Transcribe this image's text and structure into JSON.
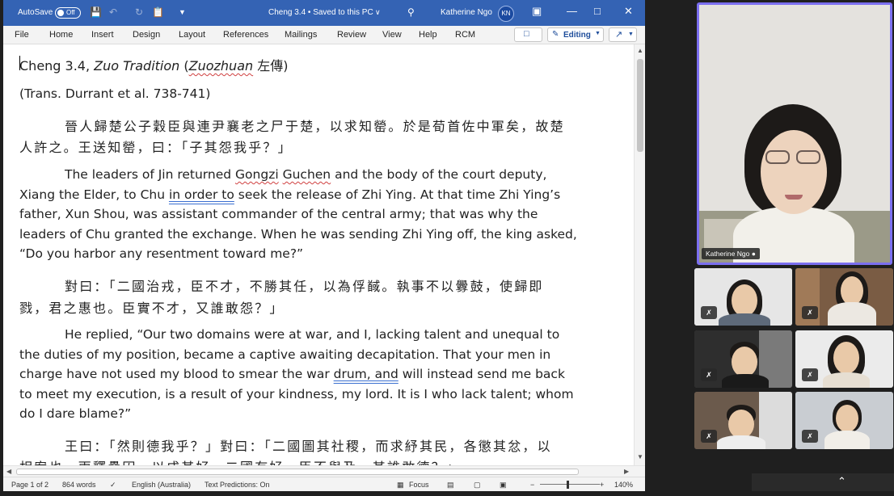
{
  "titlebar": {
    "autosave_label": "AutoSave",
    "autosave_state": "Off",
    "doc_title": "Cheng 3.4 • Saved to this PC",
    "user_name": "Katherine Ngo",
    "user_initials": "KN"
  },
  "menu": {
    "items": [
      "File",
      "Home",
      "Insert",
      "Design",
      "Layout",
      "References",
      "Mailings",
      "Review",
      "View",
      "Help",
      "RCM"
    ],
    "editing_label": "Editing"
  },
  "document": {
    "title_prefix": "Cheng 3.4, ",
    "title_italic": "Zuo Tradition",
    "title_paren_open": " (",
    "title_romanized": "Zuozhuan",
    "title_chinese": " 左傳)",
    "trans_line": "(Trans. Durrant et al. 738-741)",
    "zh1_line1": "晉人歸楚公子穀臣與連尹襄老之尸于楚，以求知罃。於是荀首佐中軍矣，故楚",
    "zh1_line2": "人許之。王送知罃，曰：「子其怨我乎？」",
    "en1_line1_a": "The leaders of Jin returned ",
    "en1_line1_b": "Gongzi",
    "en1_line1_c": " ",
    "en1_line1_d": "Guchen",
    "en1_line1_e": " and the body of the court deputy,",
    "en1_line2_a": "Xiang the Elder, to Chu ",
    "en1_line2_b": "in order to",
    "en1_line2_c": " seek the release of Zhi Ying. At that time Zhi Ying’s",
    "en1_line3": "father, Xun Shou, was assistant commander of the central army; that was why the",
    "en1_line4": "leaders of Chu granted the exchange. When he was sending Zhi Ying off, the king asked,",
    "en1_line5": "“Do you harbor any resentment toward me?”",
    "zh2_line1": "對曰：「二國治戎，臣不才，不勝其任，以為俘馘。執事不以釁鼓，使歸即",
    "zh2_line2": "戮，君之惠也。臣實不才，又誰敢怨？」",
    "en2_line1": "He replied, “Our two domains were at war, and I, lacking talent and unequal to",
    "en2_line2": "the duties of my position, became a captive awaiting decapitation. That your men in",
    "en2_line3_a": "charge have not used my blood to smear the war ",
    "en2_line3_b": "drum, and",
    "en2_line3_c": " will instead send me back",
    "en2_line4": "to meet my execution, is a result of your kindness, my lord. It is I who lack talent; whom",
    "en2_line5": "do I dare blame?”",
    "zh3_line1": "王曰：「然則德我乎？」對曰：「二國圖其社稷，而求紓其民，各懲其忿，以",
    "zh3_line2": "相宥也，兩釋纍囚，以成其好。二國有好，臣不與及，其誰敢德？」"
  },
  "statusbar": {
    "page": "Page 1 of 2",
    "words": "864 words",
    "language": "English (Australia)",
    "predictions": "Text Predictions: On",
    "focus": "Focus",
    "zoom": "140%",
    "zoom_level": 0.45
  },
  "gallery": {
    "active_speaker": "Katherine Ngo",
    "participant_count": 6
  }
}
